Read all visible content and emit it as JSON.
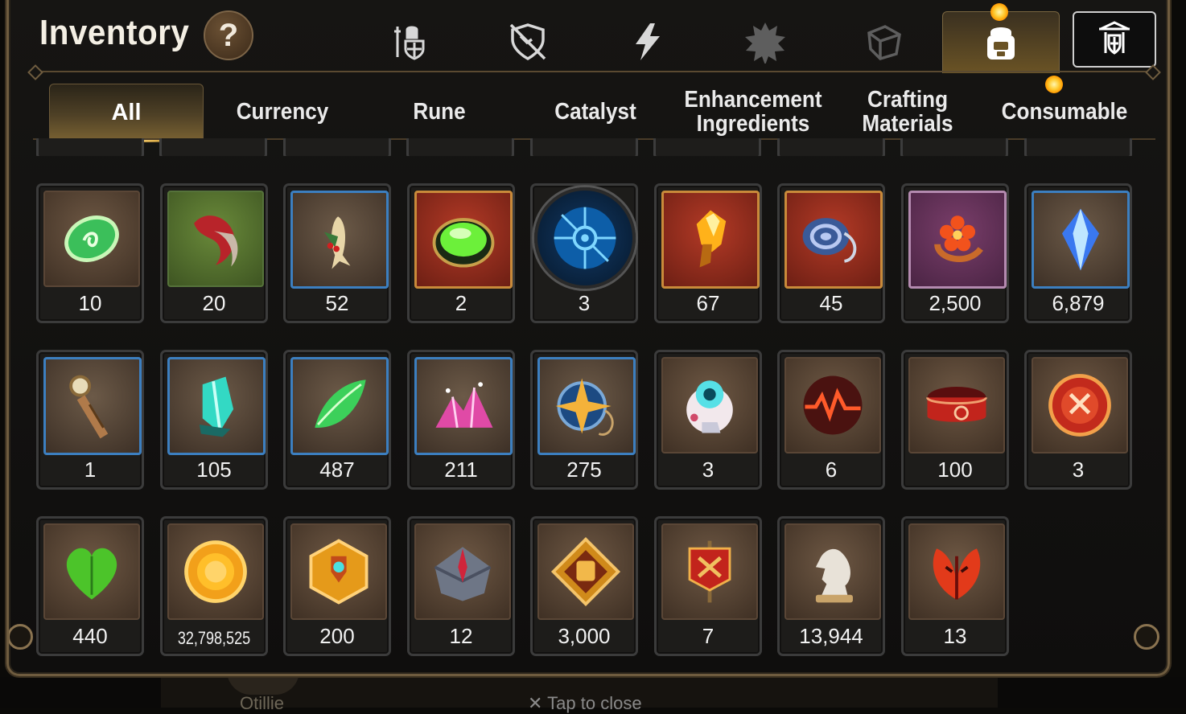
{
  "header": {
    "title": "Inventory",
    "help_label": "?"
  },
  "category_tabs": [
    {
      "icon": "hero-armor-icon",
      "state": "normal"
    },
    {
      "icon": "broken-shield-icon",
      "state": "normal"
    },
    {
      "icon": "lightning-icon",
      "state": "normal"
    },
    {
      "icon": "burst-emblem-icon",
      "state": "dim"
    },
    {
      "icon": "cube-icon",
      "state": "dim"
    },
    {
      "icon": "backpack-icon",
      "state": "active"
    },
    {
      "icon": "guild-shield-icon",
      "state": "normal"
    }
  ],
  "subtabs": [
    {
      "label": "All",
      "active": true
    },
    {
      "label": "Currency"
    },
    {
      "label": "Rune"
    },
    {
      "label": "Catalyst"
    },
    {
      "label": "Enhancement\nIngredients"
    },
    {
      "label": "Crafting\nMaterials"
    },
    {
      "label": "Consumable"
    }
  ],
  "items": [
    [
      {
        "icon": "green-rune-stone-icon",
        "qty": "10",
        "frame": "brown"
      },
      {
        "icon": "red-claw-icon",
        "qty": "20",
        "frame": "green"
      },
      {
        "icon": "ginseng-root-icon",
        "qty": "52",
        "frame": "blue"
      },
      {
        "icon": "green-gem-icon",
        "qty": "2",
        "frame": "red"
      },
      {
        "icon": "blue-rune-orb-icon",
        "qty": "3",
        "frame": "round"
      },
      {
        "icon": "flame-crystal-icon",
        "qty": "67",
        "frame": "red"
      },
      {
        "icon": "spiral-ornament-icon",
        "qty": "45",
        "frame": "red"
      },
      {
        "icon": "flower-ring-icon",
        "qty": "2,500",
        "frame": "purple"
      },
      {
        "icon": "blue-crystal-icon",
        "qty": "6,879",
        "frame": "blue"
      }
    ],
    [
      {
        "icon": "pendulum-icon",
        "qty": "1",
        "frame": "blue"
      },
      {
        "icon": "teal-crystal-icon",
        "qty": "105",
        "frame": "blue"
      },
      {
        "icon": "green-leaf-icon",
        "qty": "487",
        "frame": "blue"
      },
      {
        "icon": "pink-crystal-pile-icon",
        "qty": "211",
        "frame": "blue"
      },
      {
        "icon": "star-compass-icon",
        "qty": "275",
        "frame": "blue"
      },
      {
        "icon": "robot-pet-icon",
        "qty": "3",
        "frame": "brown"
      },
      {
        "icon": "red-heartbeat-orb-icon",
        "qty": "6",
        "frame": "brown"
      },
      {
        "icon": "red-band-icon",
        "qty": "100",
        "frame": "brown"
      },
      {
        "icon": "red-badge-icon",
        "qty": "3",
        "frame": "brown"
      }
    ],
    [
      {
        "icon": "green-heart-icon",
        "qty": "440",
        "frame": "brown"
      },
      {
        "icon": "gold-coin-icon",
        "qty": "32,798,525",
        "frame": "brown"
      },
      {
        "icon": "gold-hex-emblem-icon",
        "qty": "200",
        "frame": "brown"
      },
      {
        "icon": "stone-compass-icon",
        "qty": "12",
        "frame": "brown"
      },
      {
        "icon": "fist-emblem-icon",
        "qty": "3,000",
        "frame": "brown"
      },
      {
        "icon": "war-banner-icon",
        "qty": "7",
        "frame": "brown"
      },
      {
        "icon": "chess-knight-icon",
        "qty": "13,944",
        "frame": "brown"
      },
      {
        "icon": "red-leaves-icon",
        "qty": "13",
        "frame": "brown"
      }
    ]
  ],
  "footer": {
    "character_name": "Otillie",
    "close_hint": "✕ Tap to close"
  }
}
